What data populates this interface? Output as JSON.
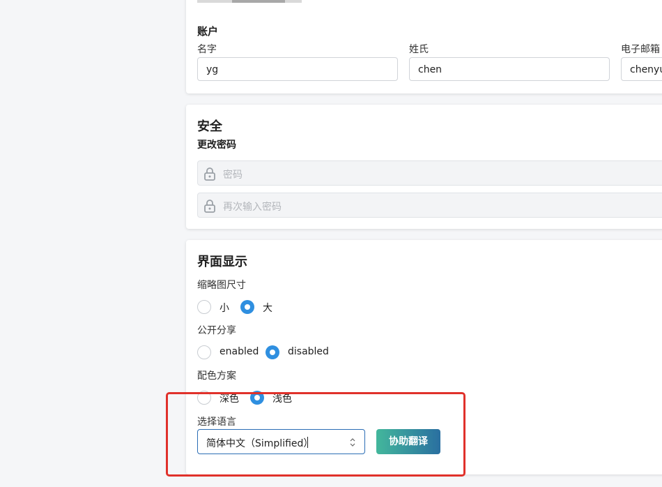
{
  "account": {
    "heading": "账户",
    "first_name": {
      "label": "名字",
      "value": "yg"
    },
    "last_name": {
      "label": "姓氏",
      "value": "chen"
    },
    "email": {
      "label": "电子邮箱",
      "value": "chenyug"
    }
  },
  "security": {
    "heading": "安全",
    "change_password_label": "更改密码",
    "password_placeholder": "密码",
    "confirm_password_placeholder": "再次输入密码"
  },
  "display": {
    "heading": "界面显示",
    "thumbnail": {
      "label": "缩略图尺寸",
      "options": [
        "小",
        "大"
      ],
      "selected": "大"
    },
    "public_share": {
      "label": "公开分享",
      "options": [
        "enabled",
        "disabled"
      ],
      "selected": "disabled"
    },
    "color_scheme": {
      "label": "配色方案",
      "options": [
        "深色",
        "浅色"
      ],
      "selected": "浅色"
    },
    "language": {
      "label": "选择语言",
      "selected": "简体中文（Simplified）"
    },
    "translate_button": "协助翻译"
  },
  "colors": {
    "accent": "#2f8fe0",
    "highlight": "#e0312b",
    "button_gradient_start": "#43b79c",
    "button_gradient_end": "#2a6fa0"
  }
}
